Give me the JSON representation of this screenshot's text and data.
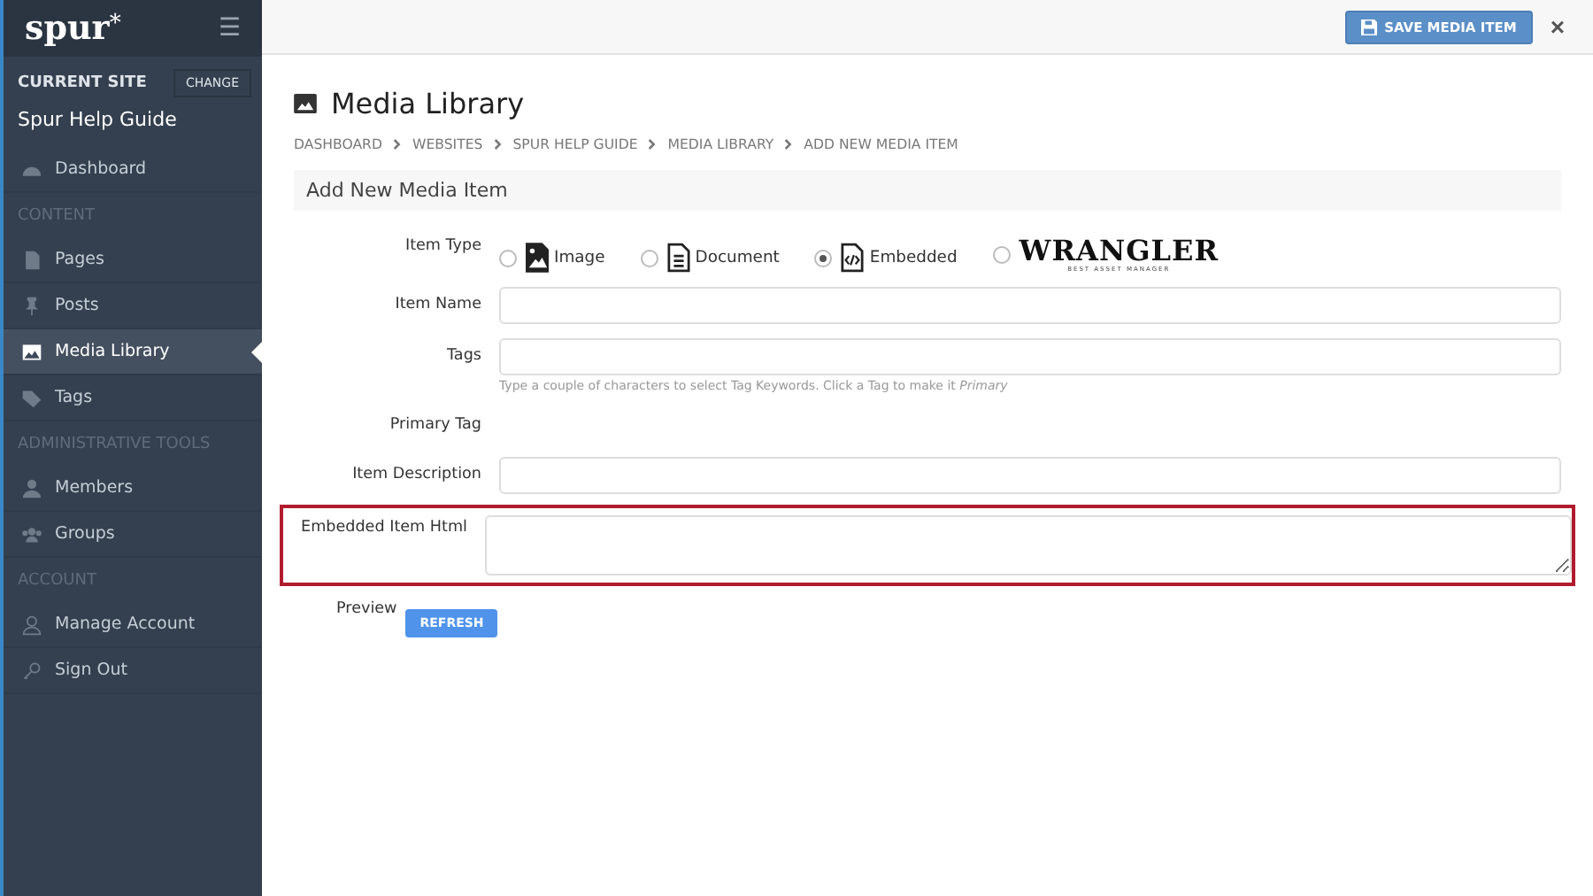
{
  "sidebar": {
    "logo": "spur",
    "logo_mark": "*",
    "menu_icon": "☰",
    "current_site_label": "CURRENT SITE",
    "change_button": "CHANGE",
    "site_name": "Spur Help Guide",
    "items": [
      {
        "kind": "link",
        "label": "Dashboard",
        "selected": false
      },
      {
        "kind": "section",
        "label": "CONTENT"
      },
      {
        "kind": "link",
        "label": "Pages",
        "selected": false
      },
      {
        "kind": "link",
        "label": "Posts",
        "selected": false
      },
      {
        "kind": "link",
        "label": "Media Library",
        "selected": true
      },
      {
        "kind": "link",
        "label": "Tags",
        "selected": false
      },
      {
        "kind": "section",
        "label": "ADMINISTRATIVE TOOLS"
      },
      {
        "kind": "link",
        "label": "Members",
        "selected": false
      },
      {
        "kind": "link",
        "label": "Groups",
        "selected": false
      },
      {
        "kind": "section",
        "label": "ACCOUNT"
      },
      {
        "kind": "link",
        "label": "Manage Account",
        "selected": false
      },
      {
        "kind": "link",
        "label": "Sign Out",
        "selected": false
      }
    ]
  },
  "toolbar": {
    "save_button": "SAVE MEDIA ITEM",
    "close": "×"
  },
  "page": {
    "title": "Media Library",
    "breadcrumbs": [
      "DASHBOARD",
      "WEBSITES",
      "SPUR HELP GUIDE",
      "MEDIA LIBRARY",
      "ADD NEW MEDIA ITEM"
    ],
    "section_title": "Add New Media Item"
  },
  "form": {
    "item_type": {
      "label": "Item Type",
      "options": [
        {
          "kind": "image",
          "label": "Image",
          "selected": false
        },
        {
          "kind": "document",
          "label": "Document",
          "selected": false
        },
        {
          "kind": "embedded",
          "label": "Embedded",
          "selected": true
        },
        {
          "kind": "logo",
          "label": "WRANGLER",
          "sublabel": "BEST ASSET MANAGER",
          "selected": false
        }
      ]
    },
    "fields": [
      {
        "kind": "input",
        "label": "Item Name",
        "highlighted": false
      },
      {
        "kind": "input",
        "label": "Tags",
        "hint": "Type a couple of characters to select Tag Keywords. Click a Tag to make it *Primary*",
        "highlighted": false
      },
      {
        "kind": "static",
        "label": "Primary Tag",
        "highlighted": false
      },
      {
        "kind": "input",
        "label": "Item Description",
        "highlighted": false
      },
      {
        "kind": "textarea",
        "label": "Embedded Item Html",
        "highlighted": true
      }
    ],
    "preview": {
      "label": "Preview",
      "button": "REFRESH"
    }
  }
}
